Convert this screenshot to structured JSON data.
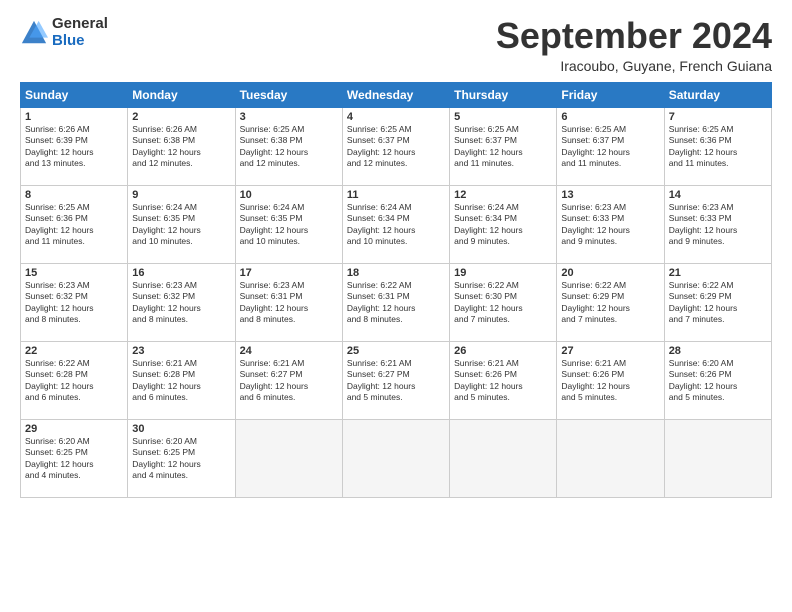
{
  "logo": {
    "general": "General",
    "blue": "Blue"
  },
  "title": "September 2024",
  "subtitle": "Iracoubo, Guyane, French Guiana",
  "weekdays": [
    "Sunday",
    "Monday",
    "Tuesday",
    "Wednesday",
    "Thursday",
    "Friday",
    "Saturday"
  ],
  "weeks": [
    [
      {
        "day": "1",
        "info": "Sunrise: 6:26 AM\nSunset: 6:39 PM\nDaylight: 12 hours\nand 13 minutes."
      },
      {
        "day": "2",
        "info": "Sunrise: 6:26 AM\nSunset: 6:38 PM\nDaylight: 12 hours\nand 12 minutes."
      },
      {
        "day": "3",
        "info": "Sunrise: 6:25 AM\nSunset: 6:38 PM\nDaylight: 12 hours\nand 12 minutes."
      },
      {
        "day": "4",
        "info": "Sunrise: 6:25 AM\nSunset: 6:37 PM\nDaylight: 12 hours\nand 12 minutes."
      },
      {
        "day": "5",
        "info": "Sunrise: 6:25 AM\nSunset: 6:37 PM\nDaylight: 12 hours\nand 11 minutes."
      },
      {
        "day": "6",
        "info": "Sunrise: 6:25 AM\nSunset: 6:37 PM\nDaylight: 12 hours\nand 11 minutes."
      },
      {
        "day": "7",
        "info": "Sunrise: 6:25 AM\nSunset: 6:36 PM\nDaylight: 12 hours\nand 11 minutes."
      }
    ],
    [
      {
        "day": "8",
        "info": "Sunrise: 6:25 AM\nSunset: 6:36 PM\nDaylight: 12 hours\nand 11 minutes."
      },
      {
        "day": "9",
        "info": "Sunrise: 6:24 AM\nSunset: 6:35 PM\nDaylight: 12 hours\nand 10 minutes."
      },
      {
        "day": "10",
        "info": "Sunrise: 6:24 AM\nSunset: 6:35 PM\nDaylight: 12 hours\nand 10 minutes."
      },
      {
        "day": "11",
        "info": "Sunrise: 6:24 AM\nSunset: 6:34 PM\nDaylight: 12 hours\nand 10 minutes."
      },
      {
        "day": "12",
        "info": "Sunrise: 6:24 AM\nSunset: 6:34 PM\nDaylight: 12 hours\nand 9 minutes."
      },
      {
        "day": "13",
        "info": "Sunrise: 6:23 AM\nSunset: 6:33 PM\nDaylight: 12 hours\nand 9 minutes."
      },
      {
        "day": "14",
        "info": "Sunrise: 6:23 AM\nSunset: 6:33 PM\nDaylight: 12 hours\nand 9 minutes."
      }
    ],
    [
      {
        "day": "15",
        "info": "Sunrise: 6:23 AM\nSunset: 6:32 PM\nDaylight: 12 hours\nand 8 minutes."
      },
      {
        "day": "16",
        "info": "Sunrise: 6:23 AM\nSunset: 6:32 PM\nDaylight: 12 hours\nand 8 minutes."
      },
      {
        "day": "17",
        "info": "Sunrise: 6:23 AM\nSunset: 6:31 PM\nDaylight: 12 hours\nand 8 minutes."
      },
      {
        "day": "18",
        "info": "Sunrise: 6:22 AM\nSunset: 6:31 PM\nDaylight: 12 hours\nand 8 minutes."
      },
      {
        "day": "19",
        "info": "Sunrise: 6:22 AM\nSunset: 6:30 PM\nDaylight: 12 hours\nand 7 minutes."
      },
      {
        "day": "20",
        "info": "Sunrise: 6:22 AM\nSunset: 6:29 PM\nDaylight: 12 hours\nand 7 minutes."
      },
      {
        "day": "21",
        "info": "Sunrise: 6:22 AM\nSunset: 6:29 PM\nDaylight: 12 hours\nand 7 minutes."
      }
    ],
    [
      {
        "day": "22",
        "info": "Sunrise: 6:22 AM\nSunset: 6:28 PM\nDaylight: 12 hours\nand 6 minutes."
      },
      {
        "day": "23",
        "info": "Sunrise: 6:21 AM\nSunset: 6:28 PM\nDaylight: 12 hours\nand 6 minutes."
      },
      {
        "day": "24",
        "info": "Sunrise: 6:21 AM\nSunset: 6:27 PM\nDaylight: 12 hours\nand 6 minutes."
      },
      {
        "day": "25",
        "info": "Sunrise: 6:21 AM\nSunset: 6:27 PM\nDaylight: 12 hours\nand 5 minutes."
      },
      {
        "day": "26",
        "info": "Sunrise: 6:21 AM\nSunset: 6:26 PM\nDaylight: 12 hours\nand 5 minutes."
      },
      {
        "day": "27",
        "info": "Sunrise: 6:21 AM\nSunset: 6:26 PM\nDaylight: 12 hours\nand 5 minutes."
      },
      {
        "day": "28",
        "info": "Sunrise: 6:20 AM\nSunset: 6:26 PM\nDaylight: 12 hours\nand 5 minutes."
      }
    ],
    [
      {
        "day": "29",
        "info": "Sunrise: 6:20 AM\nSunset: 6:25 PM\nDaylight: 12 hours\nand 4 minutes."
      },
      {
        "day": "30",
        "info": "Sunrise: 6:20 AM\nSunset: 6:25 PM\nDaylight: 12 hours\nand 4 minutes."
      },
      {
        "day": "",
        "info": ""
      },
      {
        "day": "",
        "info": ""
      },
      {
        "day": "",
        "info": ""
      },
      {
        "day": "",
        "info": ""
      },
      {
        "day": "",
        "info": ""
      }
    ]
  ]
}
